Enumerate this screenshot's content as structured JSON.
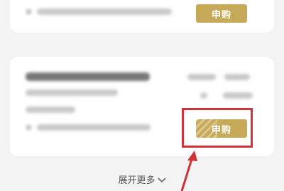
{
  "cards": [
    {
      "button_label": "申购"
    },
    {
      "button_label": "申购"
    }
  ],
  "expand_more": {
    "label": "展开更多"
  },
  "colors": {
    "button_gold": "#c7a95a",
    "annotation_red": "#d0323a"
  },
  "icons": {
    "expand": "chevron-down-icon"
  }
}
